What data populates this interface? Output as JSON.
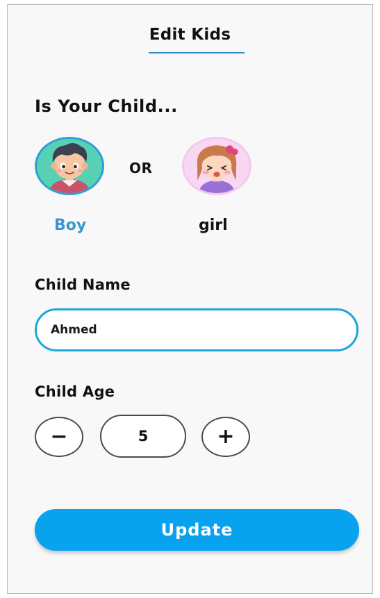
{
  "header": {
    "title": "Edit Kids"
  },
  "gender": {
    "question": "Is Your Child...",
    "separator": "OR",
    "options": [
      {
        "label": "Boy",
        "icon": "boy-avatar-icon",
        "selected": true
      },
      {
        "label": "girl",
        "icon": "girl-avatar-icon",
        "selected": false
      }
    ]
  },
  "name_field": {
    "label": "Child Name",
    "value": "Ahmed"
  },
  "age_field": {
    "label": "Child Age",
    "value": "5",
    "decrement_symbol": "−",
    "increment_symbol": "+"
  },
  "update_button": {
    "label": "Update"
  },
  "colors": {
    "accent": "#08a2ee",
    "selected_label": "#3a97d0",
    "input_border": "#1aa6dc"
  }
}
